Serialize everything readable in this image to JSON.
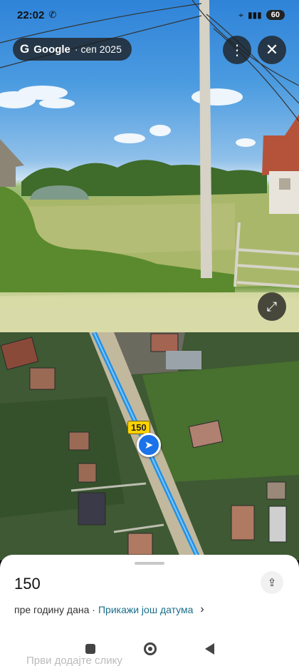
{
  "status_bar": {
    "time": "22:02",
    "battery": "60"
  },
  "header": {
    "brand": "Google",
    "date_label": "· сеп 2025",
    "more_icon": "more-vert-icon",
    "close_icon": "close-icon"
  },
  "map": {
    "route_number": "150"
  },
  "sheet": {
    "title": "150",
    "age_text": "пре годину дана ·",
    "more_dates_link": "Прикажи још датума",
    "footer_text": "Први додајте слику"
  }
}
